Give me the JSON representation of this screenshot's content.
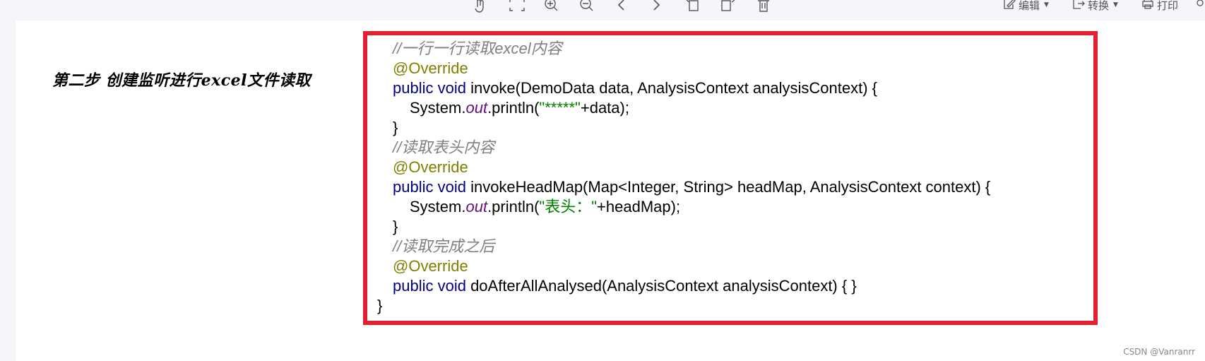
{
  "toolbar": {
    "icons": [
      "hand-icon",
      "fit-page-icon",
      "zoom-in-icon",
      "zoom-out-icon",
      "previous-page-icon",
      "next-page-icon",
      "rotate-left-icon",
      "rotate-right-icon",
      "delete-icon"
    ],
    "edit_label": "编辑",
    "convert_label": "转换",
    "print_label": "打印"
  },
  "document": {
    "step_title": "第二步  创建监听进行excel文件读取",
    "code": {
      "comment_1": "//一行一行读取excel内容",
      "override_1": "@Override",
      "l3_kw": "public void",
      "l3_rest": " invoke(DemoData data, AnalysisContext analysisContext) {",
      "l4_a": "System.",
      "l4_field": "out",
      "l4_b": ".println(",
      "l4_str": "\"*****\"",
      "l4_c": "+data);",
      "close_1": "}",
      "comment_2": "//读取表头内容",
      "override_2": "@Override",
      "l8_kw": "public void",
      "l8_rest": " invokeHeadMap(Map<Integer, String> headMap, AnalysisContext context) {",
      "l9_a": "System.",
      "l9_field": "out",
      "l9_b": ".println(",
      "l9_str": "\"表头：\"",
      "l9_c": "+headMap);",
      "close_2": "}",
      "comment_3": "//读取完成之后",
      "override_3": "@Override",
      "l13_kw": "public void",
      "l13_rest": " doAfterAllAnalysed(AnalysisContext analysisContext) { }",
      "close_class": "}"
    }
  },
  "watermark": "CSDN @Vanranrr",
  "colors": {
    "border": "#e3202f",
    "comment": "#7f7f7f",
    "annotation": "#808000",
    "keyword": "#000080",
    "field": "#660e7a",
    "string": "#008000"
  }
}
